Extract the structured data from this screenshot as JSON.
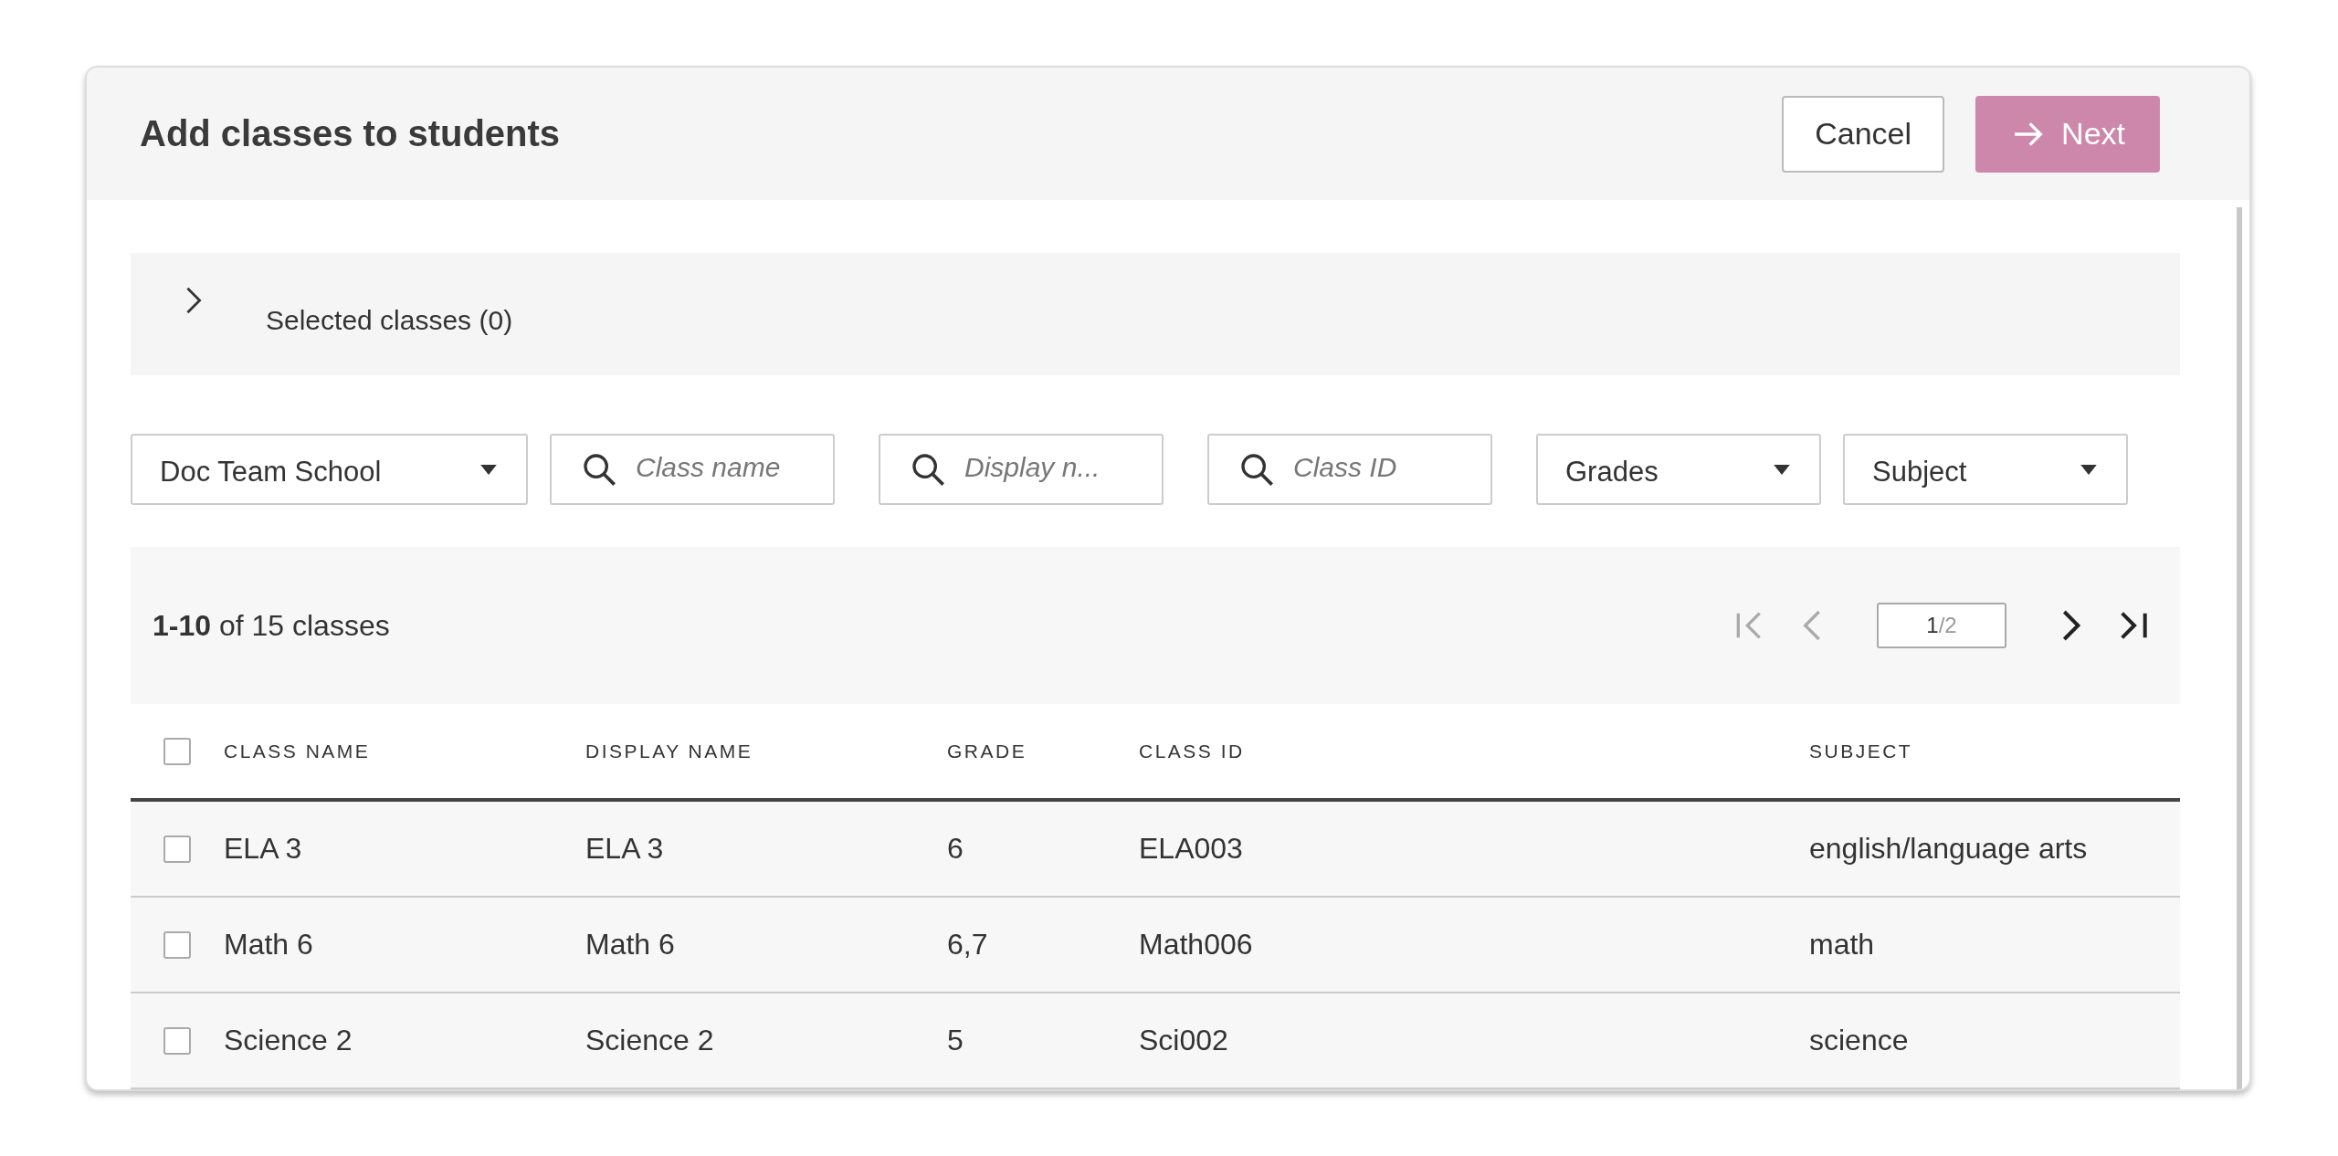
{
  "dialog": {
    "title": "Add classes to students",
    "buttons": [
      {
        "label": "Cancel",
        "kind": "secondary",
        "disabled": false
      },
      {
        "label": "Next",
        "kind": "primary",
        "disabled": true
      }
    ]
  },
  "selected_panel": {
    "label": "Selected classes (0)",
    "expanded": false
  },
  "filters": [
    {
      "kind": "dropdown",
      "value": "Doc Team School"
    },
    {
      "kind": "search",
      "placeholder": "Class name"
    },
    {
      "kind": "search",
      "placeholder": "Display n..."
    },
    {
      "kind": "search",
      "placeholder": "Class ID"
    },
    {
      "kind": "dropdown",
      "value": "Grades"
    },
    {
      "kind": "dropdown",
      "value": "Subject"
    }
  ],
  "pagination": {
    "range": "1-10",
    "summary": "of 15 classes",
    "page_current": "1",
    "page_total": "/2",
    "first_disabled": true,
    "prev_disabled": true
  },
  "table": {
    "columns": [
      "CLASS NAME",
      "DISPLAY NAME",
      "GRADE",
      "CLASS ID",
      "SUBJECT"
    ],
    "all_checked": false,
    "rows": [
      {
        "checked": false,
        "cells": [
          "ELA 3",
          "ELA 3",
          "6",
          "ELA003",
          "english/language arts"
        ]
      },
      {
        "checked": false,
        "cells": [
          "Math 6",
          "Math 6",
          "6,7",
          "Math006",
          "math"
        ]
      },
      {
        "checked": false,
        "cells": [
          "Science 2",
          "Science 2",
          "5",
          "Sci002",
          "science"
        ]
      }
    ]
  }
}
